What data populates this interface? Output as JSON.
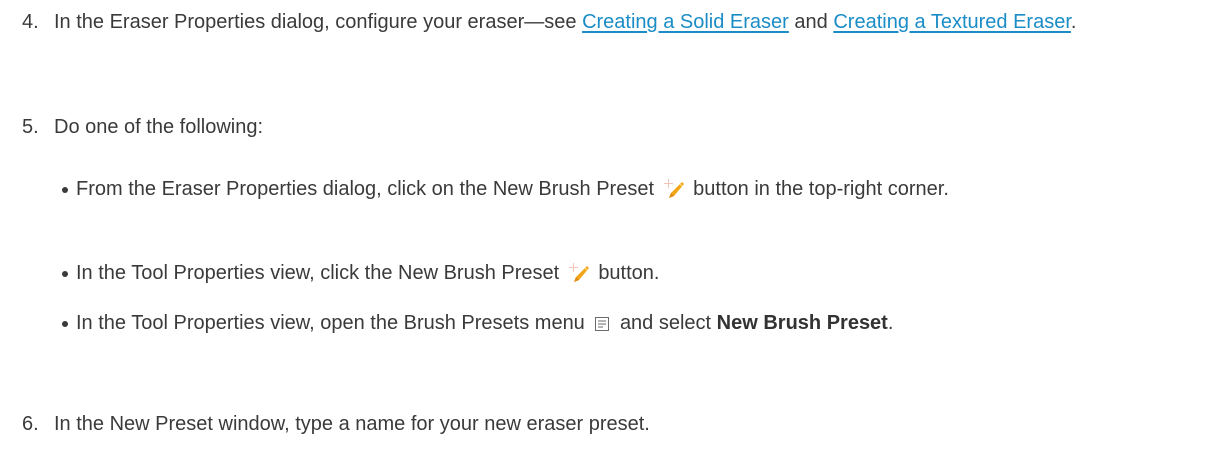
{
  "step4": {
    "number": "4.",
    "text_before": "In the Eraser Properties dialog, configure your eraser—see",
    "link1": "Creating a Solid Eraser",
    "and": "and",
    "link2": "Creating a Textured Eraser",
    "end": "."
  },
  "step5": {
    "number": "5.",
    "text": "Do one of the following:",
    "bullets": [
      {
        "before": "From the Eraser Properties dialog, click on the New Brush Preset",
        "icon": "new-brush-preset-icon",
        "after": "button in the top-right corner."
      },
      {
        "before": "In the Tool Properties view, click the New Brush Preset",
        "icon": "new-brush-preset-icon",
        "after": "button."
      },
      {
        "before": "In the Tool Properties view, open the Brush Presets menu",
        "icon": "menu-icon",
        "mid": "and select",
        "bold": "New Brush Preset",
        "end": "."
      }
    ]
  },
  "step6": {
    "number": "6.",
    "text": "In the New Preset window, type a name for your new eraser preset."
  },
  "colors": {
    "text": "#3a3a3a",
    "link": "#1a8cc6",
    "icon_orange": "#f2a516"
  }
}
